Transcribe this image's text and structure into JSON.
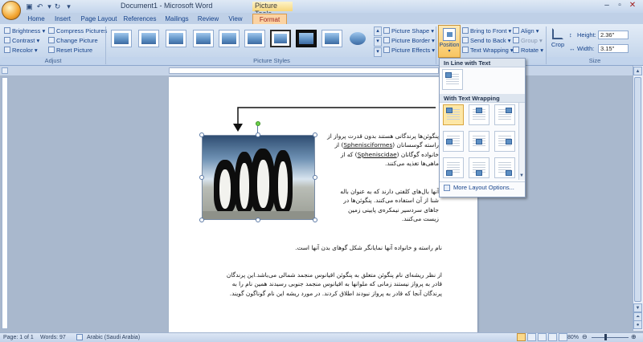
{
  "titlebar": {
    "document_title": "Document1 - Microsoft Word",
    "context_tools": "Picture Tools"
  },
  "tabs": [
    "Home",
    "Insert",
    "Page Layout",
    "References",
    "Mailings",
    "Review",
    "View",
    "Format"
  ],
  "active_tab": "Format",
  "ribbon": {
    "adjust": {
      "label": "Adjust",
      "brightness": "Brightness",
      "contrast": "Contrast",
      "recolor": "Recolor",
      "compress": "Compress Pictures",
      "change": "Change Picture",
      "reset": "Reset Picture"
    },
    "picture_styles": {
      "label": "Picture Styles",
      "shape": "Picture Shape",
      "border": "Picture Border",
      "effects": "Picture Effects"
    },
    "arrange": {
      "position": "Position",
      "bring_front": "Bring to Front",
      "send_back": "Send to Back",
      "text_wrapping": "Text Wrapping",
      "align": "Align",
      "group": "Group",
      "rotate": "Rotate"
    },
    "size": {
      "label": "Size",
      "crop": "Crop",
      "height_label": "Height:",
      "height_value": "2.36\"",
      "width_label": "Width:",
      "width_value": "3.15\""
    }
  },
  "position_menu": {
    "inline_header": "In Line with Text",
    "wrap_header": "With Text Wrapping",
    "more": "More Layout Options..."
  },
  "document": {
    "para1_line1": "پنگوئن‌ها پرندگانی هستند بدون قدرت پرواز از",
    "para1_line2_pre": "راسته گوسسانان (",
    "para1_line2_link": "Sphenisciformes",
    "para1_line2_post": ") از",
    "para1_line3_pre": "خانواده گوگانان (",
    "para1_line3_link": "Spheniscidae",
    "para1_line3_post": ") که از",
    "para1_line4": "ماهی‌ها تغذیه می‌کنند.",
    "para2_line1": "آنها بال‌های کلفتی دارند که به عنوان باله",
    "para2_line2": "شنا از آن استفاده می‌کنند. پنگوئن‌ها در",
    "para2_line3": "جاهای سردسیر نیمکره‌ی پایینی زمین",
    "para2_line4": "زیست می‌کنند.",
    "para3": "نام راسته و خانواده آنها نمایانگر شکل گوهای بدن آنها است.",
    "para4_line1": "از نظر ریشه‌ای نام پنگوئن متعلق به پنگوئن اقیانوس منجمد شمالی می‌باشد.این پرندگان",
    "para4_line2": "قادر به پرواز نیستند زمانی که ملوانها به اقیانوس منجمد جنوبی رسیدند همین نام را به",
    "para4_line3": "پرندگان آنجا که قادر به پرواز نبودند اطلاق کردند. در مورد ریشه این نام گوناگون گویند."
  },
  "statusbar": {
    "page": "Page: 1 of 1",
    "words": "Words: 97",
    "language": "Arabic (Saudi Arabia)",
    "zoom": "80%"
  }
}
